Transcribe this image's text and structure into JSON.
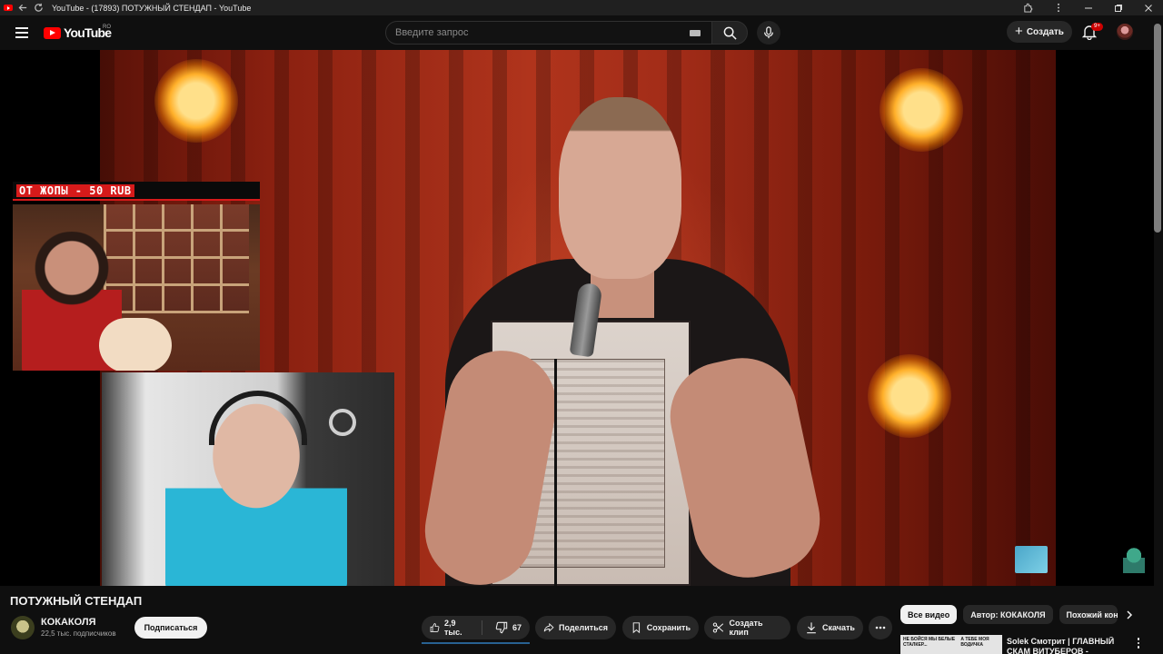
{
  "browser": {
    "tab_title": "YouTube - (17893) ПОТУЖНЫЙ СТЕНДАП - YouTube"
  },
  "header": {
    "logo_text": "YouTube",
    "region": "RO",
    "search_placeholder": "Введите запрос",
    "create_label": "Создать",
    "notifications_badge": "9+"
  },
  "player": {
    "overlay_banner": "ОТ ЖОПЫ - 50 RUB"
  },
  "video": {
    "title": "ПОТУЖНЫЙ СТЕНДАП",
    "channel_name": "КОКАКОЛЯ",
    "subscribers": "22,5 тыс. подписчиков",
    "subscribe_label": "Подписаться",
    "likes": "2,9 тыс.",
    "dislikes": "67",
    "actions": {
      "share": "Поделиться",
      "save": "Сохранить",
      "clip": "Создать клип",
      "download": "Скачать"
    }
  },
  "sidebar": {
    "chips": [
      "Все видео",
      "Автор: КОКАКОЛЯ",
      "Похожий контент"
    ],
    "recommendation": {
      "thumb_text_left": "НЕ БОЙСЯ МЫ БЕЛЫЕ СТАЛКЕР...",
      "thumb_text_right": "А ТЕБЕ МОЯ ВОДИЧКА",
      "title": "Solek Смотрит | ГЛАВНЫЙ СКАМ ВИТУБЕРОВ -"
    }
  },
  "icons": {
    "favicon": "youtube-favicon",
    "back": "back-arrow-icon",
    "reload": "reload-icon",
    "extensions": "extensions-icon",
    "menu": "menu-icon",
    "search": "search-icon",
    "mic": "microphone-icon",
    "bell": "bell-icon",
    "like": "thumbs-up-icon",
    "dislike": "thumbs-down-icon",
    "share": "share-icon",
    "save": "playlist-save-icon",
    "clip": "scissors-icon",
    "download": "download-icon",
    "more": "more-icon",
    "chevron": "chevron-right-icon"
  },
  "colors": {
    "brand_red": "#ff0000",
    "background": "#0f0f0f",
    "pill": "#272727",
    "banner_red": "#d61a1a"
  }
}
